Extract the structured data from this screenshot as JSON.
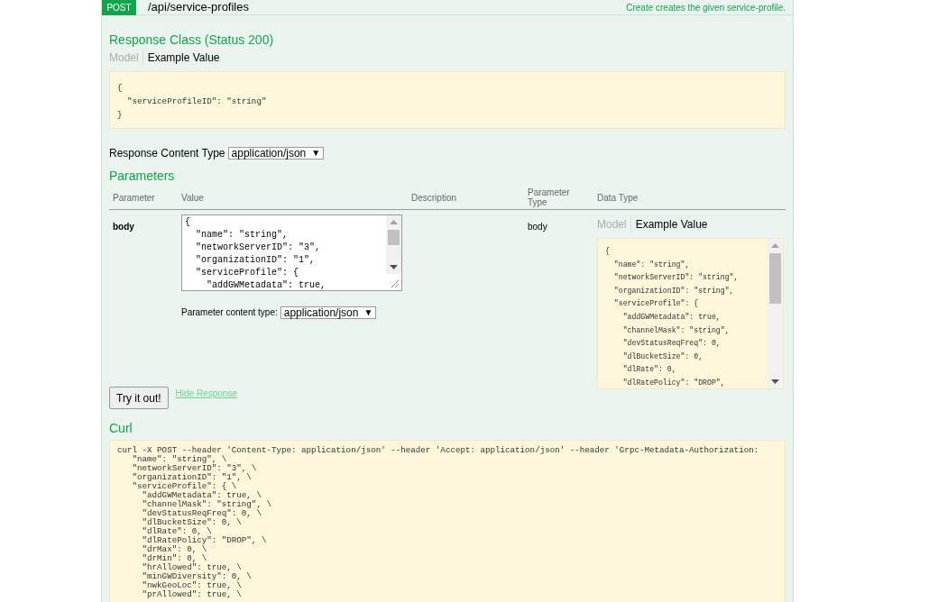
{
  "operation": {
    "method": "POST",
    "path": "/api/service-profiles",
    "summary": "Create creates the given service-profile."
  },
  "response_class": {
    "heading": "Response Class (Status 200)",
    "tabs": [
      {
        "label": "Model",
        "selected": false
      },
      {
        "label": "Example Value",
        "selected": true
      }
    ],
    "example_lines": [
      "{",
      "  \"serviceProfileID\": \"string\"",
      "}"
    ]
  },
  "response_content_type": {
    "label": "Response Content Type",
    "value": "application/json",
    "arrow": "▼"
  },
  "parameters": {
    "heading": "Parameters",
    "columns": [
      "Parameter",
      "Value",
      "Description",
      "Parameter Type",
      "Data Type"
    ],
    "rows": [
      {
        "parameter": "body",
        "value_lines": [
          "{",
          "  \"name\": \"string\",",
          "  \"networkServerID\": \"3\",",
          "  \"organizationID\": \"1\",",
          "  \"serviceProfile\": {",
          "    \"addGWMetadata\": true,"
        ],
        "content_type_label": "Parameter content type:",
        "content_type_value": "application/json",
        "content_type_arrow": "▼",
        "parameter_type": "body",
        "data_type_tabs": [
          {
            "label": "Model",
            "selected": false
          },
          {
            "label": "Example Value",
            "selected": true
          }
        ],
        "example_lines": [
          "{",
          "  \"name\": \"string\",",
          "  \"networkServerID\": \"string\",",
          "  \"organizationID\": \"string\",",
          "  \"serviceProfile\": {",
          "    \"addGWMetadata\": true,",
          "    \"channelMask\": \"string\",",
          "    \"devStatusReqFreq\": 0,",
          "    \"dlBucketSize\": 0,",
          "    \"dlRate\": 0,",
          "    \"dlRatePolicy\": \"DROP\","
        ]
      }
    ]
  },
  "actions": {
    "try_button": "Try it out!",
    "hide_link": "Hide Response"
  },
  "curl": {
    "heading": "Curl",
    "lines": [
      "curl -X POST --header 'Content-Type: application/json' --header 'Accept: application/json' --header 'Grpc-Metadata-Authorization:",
      "   \"name\": \"string\", \\",
      "   \"networkServerID\": \"3\", \\",
      "   \"organizationID\": \"1\", \\",
      "   \"serviceProfile\": { \\",
      "     \"addGWMetadata\": true, \\",
      "     \"channelMask\": \"string\", \\",
      "     \"devStatusReqFreq\": 0, \\",
      "     \"dlBucketSize\": 0, \\",
      "     \"dlRate\": 0, \\",
      "     \"dlRatePolicy\": \"DROP\", \\",
      "     \"drMax\": 0, \\",
      "     \"drMin\": 0, \\",
      "     \"hrAllowed\": true, \\",
      "     \"minGWDiversity\": 0, \\",
      "     \"nwkGeoLoc\": true, \\",
      "     \"prAllowed\": true, \\"
    ]
  }
}
